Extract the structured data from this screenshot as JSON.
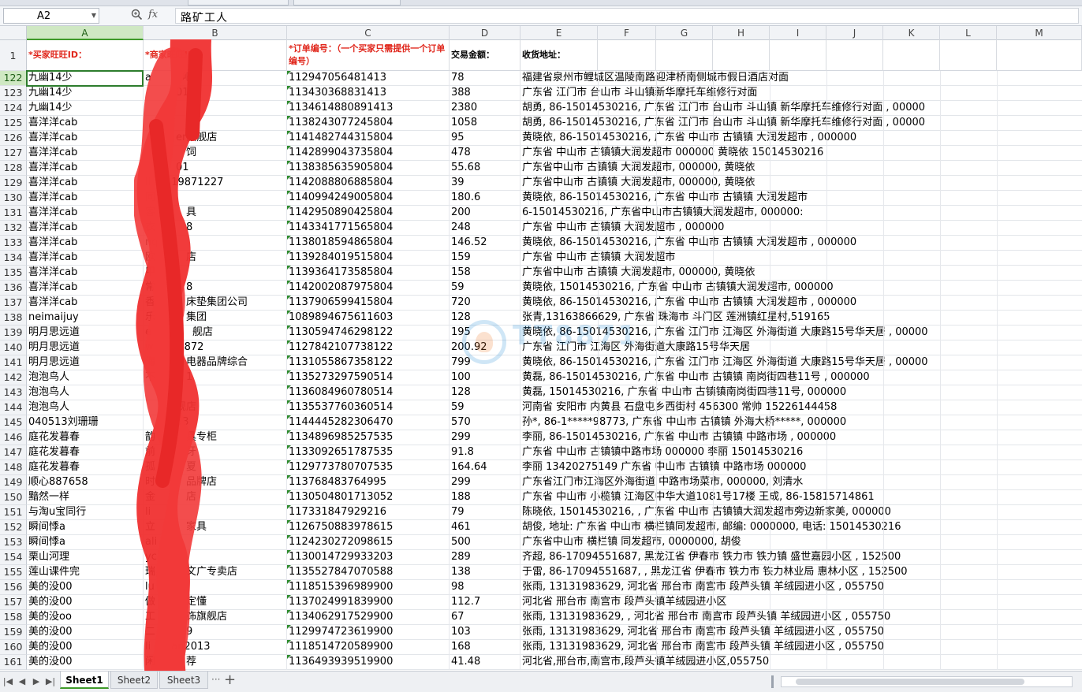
{
  "formula_bar": {
    "name_box": "A2",
    "fx_label": "fx",
    "content": "路矿工人"
  },
  "columns": [
    "A",
    "B",
    "C",
    "D",
    "E",
    "F",
    "G",
    "H",
    "I",
    "J",
    "K",
    "L",
    "M"
  ],
  "header_row": {
    "row_num": "1",
    "a": "*买家旺旺ID：",
    "b": "*商家旺旺ID：",
    "c": "*订单编号：（一个买家只需提供一个订单编号）",
    "d": "交易金额：",
    "e": "收货地址："
  },
  "rows": [
    {
      "n": "122",
      "a": "九幽14少",
      "b": "a　　　吧",
      "c": "112947056481413",
      "d": "78",
      "e": "福建省泉州市鲤城区温陵南路迎津桥南侧城市假日酒店对面"
    },
    {
      "n": "123",
      "a": "九幽14少",
      "b": "　　　01",
      "c": "113430368831413",
      "d": "388",
      "e": "广东省 江门市 台山市 斗山镇新华摩托车维修行对面"
    },
    {
      "n": "124",
      "a": "九幽14少",
      "b": "　　　　6",
      "c": "113461488089141​3",
      "d": "2380",
      "e": "胡勇, 86-15014530216, 广东省 江门市 台山市 斗山镇 新华摩托车维修行对面 , 00000"
    },
    {
      "n": "125",
      "a": "喜洋洋cab",
      "b": "　",
      "c": "113824307724580​4",
      "d": "1058",
      "e": "胡勇, 86-15014530216, 广东省 江门市 台山市 斗山镇 新华摩托车维修行对面 , 00000"
    },
    {
      "n": "126",
      "a": "喜洋洋cab",
      "b": "　　　er旗舰店",
      "c": "114148274431580​4",
      "d": "95",
      "e": "黄晓依, 86-15014530216, 广东省 中山市 古镇镇 大润发超市 , 000000"
    },
    {
      "n": "127",
      "a": "喜洋洋cab",
      "b": "　　　　饲",
      "c": "114289904373580​4",
      "d": "478",
      "e": "广东省  中山市  古镇镇大润发超市  000000  黄晓依  15014530216"
    },
    {
      "n": "128",
      "a": "喜洋洋cab",
      "b": "　　　01",
      "c": "113838563590580​4",
      "d": "55.68",
      "e": "广东省中山市 古镇镇 大润发超市, 000000, 黄晓依"
    },
    {
      "n": "129",
      "a": "喜洋洋cab",
      "b": "li　　19871227",
      "c": "114208880688580​4",
      "d": "39",
      "e": "广东省中山市 古镇镇 大润发超市, 000000, 黄晓依"
    },
    {
      "n": "130",
      "a": "喜洋洋cab",
      "b": "同",
      "c": "114099424900580​4",
      "d": "180.6",
      "e": "黄晓依, 86-15014530216, 广东省 中山市 古镇镇 大润发超市"
    },
    {
      "n": "131",
      "a": "喜洋洋cab",
      "b": "客　　　具",
      "c": "114295089042580​4",
      "d": "200",
      "e": "6-15014530216, 广东省中山市古镇镇大润发超市, 000000:"
    },
    {
      "n": "132",
      "a": "喜洋洋cab",
      "b": "衣　　　8",
      "c": "114334177156580​4",
      "d": "248",
      "e": " 广东省 中山市 古镇镇 大润发超市 , 000000"
    },
    {
      "n": "133",
      "a": "喜洋洋cab",
      "b": "nq",
      "c": "113801859486580​4",
      "d": "146.52",
      "e": "黄晓依, 86-15014530216, 广东省 中山市 古镇镇 大润发超市 , 000000"
    },
    {
      "n": "134",
      "a": "喜洋洋cab",
      "b": "欧　　　店",
      "c": "113928401951580​4",
      "d": "159",
      "e": "广东省 中山市 古镇镇 大润发超市"
    },
    {
      "n": "135",
      "a": "喜洋洋cab",
      "b": "甲",
      "c": "113936417358580​4",
      "d": "158",
      "e": "广东省中山市 古镇镇 大润发超市, 000000, 黄晓依"
    },
    {
      "n": "136",
      "a": "喜洋洋cab",
      "b": "常　　　8",
      "c": "114200208797580​4",
      "d": "59",
      "e": "黄晓依, 15014530216, 广东省 中山市 古镇镇大润发超市, 000000"
    },
    {
      "n": "137",
      "a": "喜洋洋cab",
      "b": "香　　　床垫集团公司",
      "c": "113790659941580​4",
      "d": "720",
      "e": "黄晓依, 86-15014530216, 广东省 中山市 古镇镇 大润发超市 , 000000"
    },
    {
      "n": "138",
      "a": "neimaijuy",
      "b": "乐　　　集团",
      "c": "108989467561160​3",
      "d": "128",
      "e": "张青,13163866629, 广东省 珠海市 斗门区 莲洲镇红星村,519165"
    },
    {
      "n": "139",
      "a": "明月思远道",
      "b": "e　　　　舰店",
      "c": "113059474629812​2",
      "d": "195",
      "e": "黄晓依, 86-15014530216, 广东省 江门市 江海区 外海街道 大康路15号华天居 , 00000"
    },
    {
      "n": "140",
      "a": "明月思远道",
      "b": "w　　　872",
      "c": "112784210773812​2",
      "d": "200.92",
      "e": "广东省 江门市 江海区 外海街道大康路15号华天居"
    },
    {
      "n": "141",
      "a": "明月思远道",
      "b": "海　　　电器品牌综合",
      "c": "113105586735812​2",
      "d": "799",
      "e": "黄晓依, 86-15014530216, 广东省 江门市 江海区 外海街道 大康路15号华天居 , 00000"
    },
    {
      "n": "142",
      "a": "泡泡鸟人",
      "b": "不　　　1",
      "c": "113527329759051​4",
      "d": "100",
      "e": "黄磊, 86-15014530216, 广东省 中山市 古镇镇 南岗街四巷11号 , 000000"
    },
    {
      "n": "143",
      "a": "泡泡鸟人",
      "b": "　",
      "c": "113608496078051​4",
      "d": "128",
      "e": "黄磊, 15014530216, 广东省 中山市 古镇镇南岗街四巷11号, 000000"
    },
    {
      "n": "144",
      "a": "泡泡鸟人",
      "b": "　　　舰店",
      "c": "113553776036051​4",
      "d": "59",
      "e": "河南省  安阳市  内黄县  石盘屯乡西街村  456300  常帅  15226144458"
    },
    {
      "n": "145",
      "a": "040513刘珊珊",
      "b": "　　　83",
      "c": "114444528230647​0",
      "d": "570",
      "e": "孙*, 86-1*****98773, 广东省  中山市  古镇镇  外海大桥*****, 000000"
    },
    {
      "n": "146",
      "a": "庭花发暮春",
      "b": "韵　　　具专柜",
      "c": "113489698525753​5",
      "d": "299",
      "e": "李丽, 86-15014530216, 广东省 中山市 古镇镇 中路市场 , 000000"
    },
    {
      "n": "147",
      "a": "庭花发暮春",
      "b": "前　　　牙",
      "c": "113309265178753​5",
      "d": "91.8",
      "e": " 广东省  中山市  古镇镇中路市场  000000  李丽  15014530216"
    },
    {
      "n": "148",
      "a": "庭花发暮春",
      "b": "孤　　　夏",
      "c": "112977378070753​5",
      "d": "164.64",
      "e": "李丽  13420275149 广东省 中山市 古镇镇 中路市场 000000"
    },
    {
      "n": "149",
      "a": "顺心887658",
      "b": "时　　　品牌店",
      "c": "113768483764995",
      "d": "299",
      "e": "广东省江门市江海区外海街道 中路市场菜市, 000000, 刘清水"
    },
    {
      "n": "150",
      "a": "黯然一样",
      "b": "金　　　店",
      "c": "113050480171305​2",
      "d": "188",
      "e": "广东省 中山市 小榄镇 江海区中华大道1081号17楼  王成, 86-15815714861"
    },
    {
      "n": "151",
      "a": "与淘u宝同行",
      "b": "li",
      "c": "117331847929216",
      "d": "79",
      "e": "陈晓依, 15014530216, , 广东省 中山市 古镇镇大润发超市旁边新家美, 000000"
    },
    {
      "n": "152",
      "a": "瞬间悸a",
      "b": "立　　　家具",
      "c": "112675088397861​5",
      "d": "461",
      "e": "胡俊, 地址: 广东省 中山市 横栏镇同发超市, 邮编: 0000000, 电话: 15014530216"
    },
    {
      "n": "153",
      "a": "瞬间悸a",
      "b": "ali",
      "c": "112423027209861​5",
      "d": "500",
      "e": " 广东省中山市 横栏镇 同发超市, 0000000, 胡俊"
    },
    {
      "n": "154",
      "a": "栗山河理",
      "b": "yc",
      "c": "113001472993320​3",
      "d": "289",
      "e": "齐超, 86-17094551687, 黑龙江省 伊春市 铁力市 铁力镇 盛世嘉园小区 , 152500"
    },
    {
      "n": "155",
      "a": "莲山课件完",
      "b": "瑞　　　文广专卖店",
      "c": "113552784707058​8",
      "d": "138",
      "e": "于雷, 86-17094551687, , 黑龙江省 伊春市 铁力市 铁力林业局 惠林小区 , 152500"
    },
    {
      "n": "156",
      "a": "美的没00",
      "b": "lu",
      "c": "111851539698990​0",
      "d": "98",
      "e": "张雨, 13131983629, 河北省 邢台市 南宫市 段芦头镇 羊绒园进小区 , 055750"
    },
    {
      "n": "157",
      "a": "美的没00",
      "b": "做　　　定懂",
      "c": "113702499183990​0",
      "d": "112.7",
      "e": "河北省  邢台市  南宫市  段芦头镇羊绒园进小区"
    },
    {
      "n": "158",
      "a": "美的没oo",
      "b": "工　　　饰旗舰店",
      "c": "113406291752990​0",
      "d": "67",
      "e": "张雨, 13131983629, , 河北省 邢台市 南宫市 段芦头镇 羊绒园进小区 , 055750"
    },
    {
      "n": "159",
      "a": "美的没00",
      "b": "二　　　9",
      "c": "112997472361990​0",
      "d": "103",
      "e": "张雨, 13131983629, 河北省 邢台市 南宫市 段芦头镇 羊绒园进小区 , 055750"
    },
    {
      "n": "160",
      "a": "美的没00",
      "b": "li　　an2013",
      "c": "111851472058990​0",
      "d": "168",
      "e": "张雨, 13131983629, 河北省 邢台市 南宫市 段芦头镇 羊绒园进小区 , 055750"
    },
    {
      "n": "161",
      "a": "美的没00",
      "b": "闲　　　荐",
      "c": "113649393951990​0",
      "d": "41.48",
      "e": "河北省,邢台市,南宫市,段芦头镇羊绒园进小区,055750"
    }
  ],
  "sheet_tabs": [
    "Sheet1",
    "Sheet2",
    "Sheet3"
  ],
  "sheet_more": "···",
  "add_sheet": "+",
  "watermark": "TT8871"
}
